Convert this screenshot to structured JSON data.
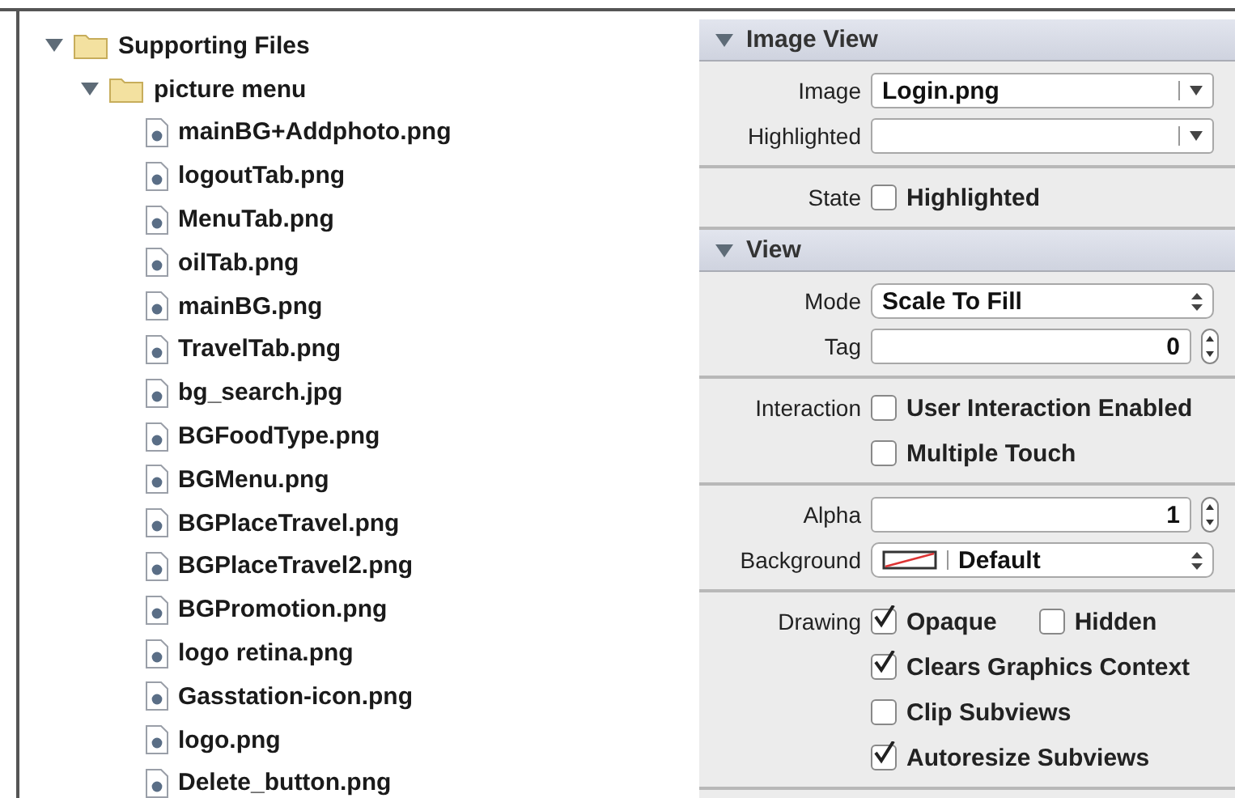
{
  "navigator": {
    "items": [
      {
        "kind": "folder",
        "name": "Supporting Files",
        "expanded": true,
        "children": [
          {
            "kind": "folder",
            "name": "picture menu",
            "expanded": true,
            "children": [
              {
                "kind": "file",
                "name": "mainBG+Addphoto.png"
              },
              {
                "kind": "file",
                "name": "logoutTab.png"
              },
              {
                "kind": "file",
                "name": "MenuTab.png"
              },
              {
                "kind": "file",
                "name": "oilTab.png"
              },
              {
                "kind": "file",
                "name": "mainBG.png"
              },
              {
                "kind": "file",
                "name": "TravelTab.png"
              },
              {
                "kind": "file",
                "name": "bg_search.jpg"
              },
              {
                "kind": "file",
                "name": "BGFoodType.png"
              },
              {
                "kind": "file",
                "name": "BGMenu.png"
              },
              {
                "kind": "file",
                "name": "BGPlaceTravel.png"
              },
              {
                "kind": "file",
                "name": "BGPlaceTravel2.png"
              },
              {
                "kind": "file",
                "name": "BGPromotion.png"
              },
              {
                "kind": "file",
                "name": "logo retina.png"
              },
              {
                "kind": "file",
                "name": "Gasstation-icon.png"
              },
              {
                "kind": "file",
                "name": "logo.png"
              },
              {
                "kind": "file",
                "name": "Delete_button.png"
              }
            ]
          }
        ]
      }
    ]
  },
  "inspector": {
    "sections": [
      {
        "title": "Image View",
        "expanded": true,
        "groups": [
          [
            {
              "kind": "combo",
              "label": "Image",
              "value": "Login.png"
            },
            {
              "kind": "combo",
              "label": "Highlighted"
            }
          ],
          [
            {
              "kind": "checks",
              "label": "State",
              "checks": [
                {
                  "label": "Highlighted",
                  "checked": false
                }
              ]
            }
          ]
        ]
      },
      {
        "title": "View",
        "expanded": true,
        "groups": [
          [
            {
              "kind": "popup",
              "label": "Mode",
              "value": "Scale To Fill"
            },
            {
              "kind": "stepper",
              "label": "Tag",
              "value": "0"
            }
          ],
          [
            {
              "kind": "checks",
              "label": "Interaction",
              "checks": [
                {
                  "label": "User Interaction Enabled",
                  "checked": false
                }
              ]
            },
            {
              "kind": "checks",
              "checks": [
                {
                  "label": "Multiple Touch",
                  "checked": false
                }
              ]
            }
          ],
          [
            {
              "kind": "stepper",
              "label": "Alpha",
              "value": "1"
            },
            {
              "kind": "color",
              "label": "Background",
              "value": "Default"
            }
          ],
          [
            {
              "kind": "checks",
              "label": "Drawing",
              "checks": [
                {
                  "label": "Opaque",
                  "checked": true
                },
                {
                  "label": "Hidden",
                  "checked": false
                }
              ]
            },
            {
              "kind": "checks",
              "checks": [
                {
                  "label": "Clears Graphics Context",
                  "checked": true
                }
              ]
            },
            {
              "kind": "checks",
              "checks": [
                {
                  "label": "Clip Subviews",
                  "checked": false
                }
              ]
            },
            {
              "kind": "checks",
              "checks": [
                {
                  "label": "Autoresize Subviews",
                  "checked": true
                }
              ]
            }
          ]
        ]
      }
    ]
  }
}
